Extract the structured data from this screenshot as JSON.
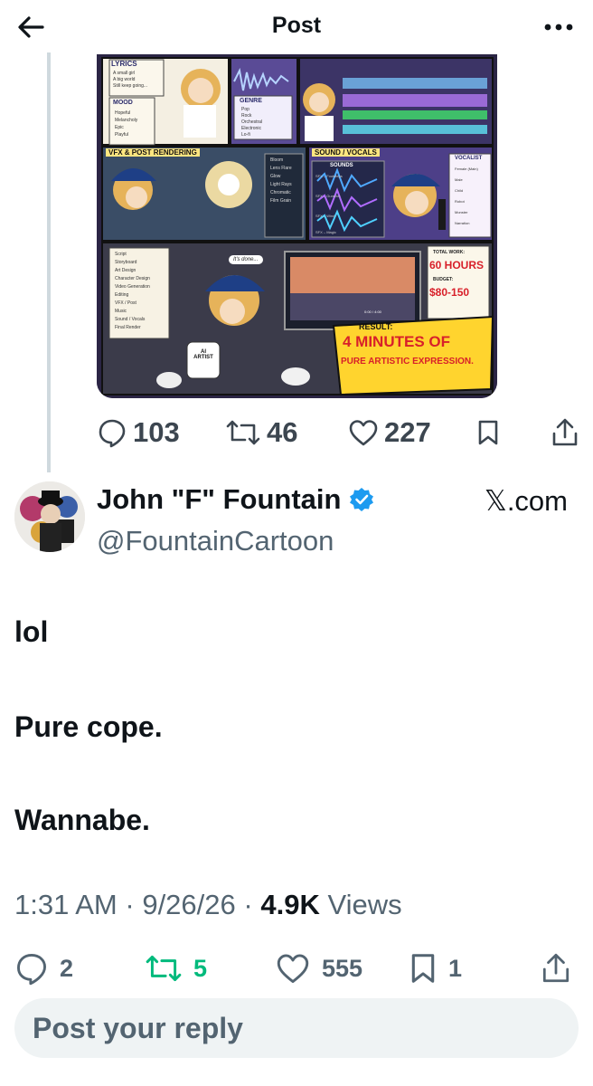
{
  "header": {
    "title": "Post",
    "back_icon": "arrow-left-icon",
    "more_icon": "more-horizontal-icon"
  },
  "quoted_post": {
    "media_panels": {
      "lyrics_title": "LYRICS",
      "lyrics_lines": [
        "A small girl",
        "A big world",
        "Still keep going..."
      ],
      "mood_title": "MOOD",
      "mood_options": [
        "Hopeful",
        "Melancholy",
        "Epic",
        "Playful"
      ],
      "genre_title": "GENRE",
      "genre_options": [
        "Pop",
        "Rock",
        "Orchestral",
        "Electronic",
        "Lo-fi"
      ],
      "vfx_title": "VFX & POST RENDERING",
      "vfx_options": [
        "Bloom",
        "Lens Flare",
        "Glow",
        "Light Rays",
        "Chromatic",
        "Film Grain"
      ],
      "sound_title": "SOUND / VOCALS",
      "sounds_label": "SOUNDS",
      "sound_tracks": [
        "SFX – Footsteps",
        "SFX – Gunshot",
        "SFX – Wind",
        "SFX – Magic"
      ],
      "vocalist_title": "VOCALIST",
      "vocalist_options": [
        "Female (Main)",
        "Male",
        "Child",
        "Robot",
        "Monster",
        "Narration"
      ],
      "checklist": [
        "Script",
        "Storyboard",
        "Art Design",
        "Character Design",
        "Video Generation",
        "Editing",
        "VFX / Post",
        "Music",
        "Sound / Vocals",
        "Final Render"
      ],
      "speech": "It's done...",
      "mug_text": "AI ARTIST",
      "player_time": "0:00 / 4:00",
      "total_work_label": "TOTAL WORK:",
      "total_work_value": "60 HOURS",
      "budget_label": "BUDGET:",
      "budget_value": "$80-150",
      "result_label": "RESULT:",
      "result_line1": "4 MINUTES OF",
      "result_line2": "PURE ARTISTIC EXPRESSION."
    },
    "stats": {
      "replies": "103",
      "reposts": "46",
      "likes": "227"
    }
  },
  "post": {
    "author_name": "John \"F\" Fountain",
    "author_handle": "@FountainCartoon",
    "source": "𝕏.com",
    "body": [
      "lol",
      "Pure cope.",
      "Wannabe."
    ],
    "time": "1:31 AM",
    "sep": "·",
    "date": "9/26/26",
    "views_count": "4.9K",
    "views_label": "Views",
    "stats": {
      "replies": "2",
      "reposts": "5",
      "likes": "555",
      "bookmarks": "1"
    }
  },
  "reply": {
    "placeholder": "Post your reply"
  },
  "colors": {
    "accent": "#1d9bf0",
    "repost_active": "#00ba7c",
    "muted": "#536471",
    "text": "#0f1419"
  }
}
